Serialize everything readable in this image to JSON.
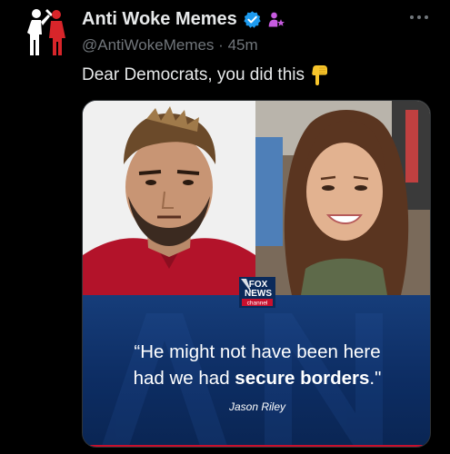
{
  "author": {
    "display_name": "Anti Woke Memes",
    "handle": "@AntiWokeMemes",
    "separator": "·",
    "time": "45m",
    "avatar_icon": "silhouette-duo-avatar",
    "verified_icon": "verified-badge-icon",
    "affiliation_icon": "purple-person-star-icon",
    "verified_color": "#1d9bf0",
    "affiliation_color": "#c75be0"
  },
  "tweet": {
    "text": "Dear Democrats, you did this",
    "emoji": "pointing-down-emoji"
  },
  "media": {
    "logo_line1": "FOX",
    "logo_line2": "NEWS",
    "logo_line3": "channel",
    "quote_line1": "“He might not have been here",
    "quote_line2_start": "had we had ",
    "quote_line2_bold": "secure borders",
    "quote_line2_end": ".\"",
    "attribution": "Jason Riley",
    "banner_color": "#0d2d63",
    "stripe_color": "#c8102e"
  }
}
